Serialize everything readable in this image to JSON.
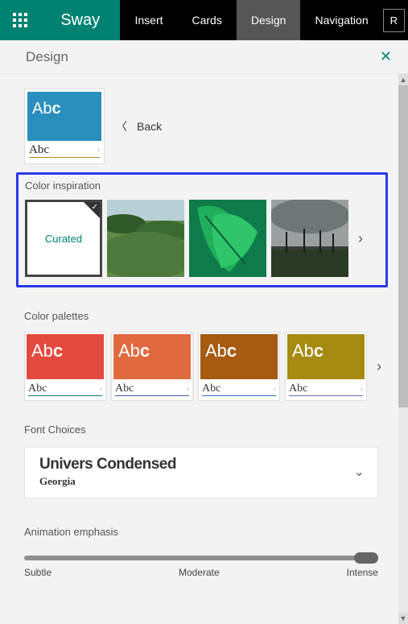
{
  "header": {
    "brand": "Sway",
    "tabs": [
      "Insert",
      "Cards",
      "Design",
      "Navigation"
    ],
    "active_tab": 2,
    "right_button": "R"
  },
  "panel": {
    "title": "Design",
    "back_label": "Back"
  },
  "theme_preview": {
    "top_text": "Abc",
    "bottom_text": "Abc"
  },
  "sections": {
    "color_inspiration": "Color inspiration",
    "color_palettes": "Color palettes",
    "font_choices": "Font Choices",
    "animation_emphasis": "Animation emphasis"
  },
  "inspiration": {
    "curated_label": "Curated",
    "items": [
      {
        "type": "curated",
        "selected": true
      },
      {
        "type": "image",
        "name": "tea-field"
      },
      {
        "type": "image",
        "name": "green-leaves"
      },
      {
        "type": "image",
        "name": "cloudy-palms"
      }
    ]
  },
  "palettes": [
    {
      "top_bg": "#e34a3f",
      "underline": "#0b7a6e",
      "label_top": "Abc",
      "label_bot": "Abc"
    },
    {
      "top_bg": "#e06a3f",
      "underline": "#4b5fae",
      "label_top": "Abc",
      "label_bot": "Abc"
    },
    {
      "top_bg": "#a65a12",
      "underline": "#2f6fb3",
      "label_top": "Abc",
      "label_bot": "Abc"
    },
    {
      "top_bg": "#a68a12",
      "underline": "#5b6fb3",
      "label_top": "Abc",
      "label_bot": "Abc"
    }
  ],
  "fonts": {
    "primary": "Univers Condensed",
    "secondary": "Georgia"
  },
  "slider": {
    "labels": [
      "Subtle",
      "Moderate",
      "Intense"
    ],
    "value": "Intense"
  }
}
